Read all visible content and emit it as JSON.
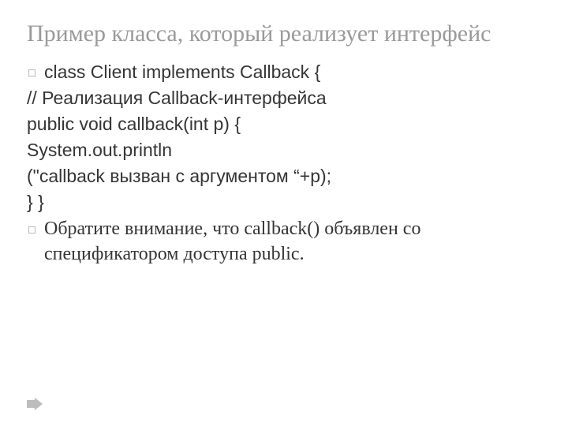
{
  "title": "Пример класса, который реализует интерфейс",
  "lines": {
    "l1": "class Client implements Callback  {",
    "l2": "// Реализация Callback-интерфейса",
    "l3": "public void callback(int p)   {",
    "l4": "System.out.println",
    "l5": "(\"callback вызван с аргументом “+p);",
    "l6": "} }",
    "l7": "Обратите внимание, что callback()   объявлен со спецификатором доступа public."
  }
}
